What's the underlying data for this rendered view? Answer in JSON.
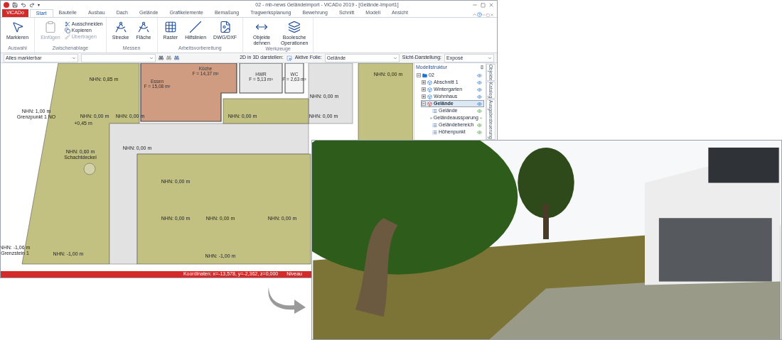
{
  "window": {
    "title": "02 - mb-news Geländeimport - ViCADo 2019 - [Gelände-Import1]"
  },
  "quick_access": {
    "more": "▾"
  },
  "file_tab": "ViCADo",
  "tabs": [
    {
      "label": "Start",
      "selected": true
    },
    {
      "label": "Bauteile",
      "selected": false
    },
    {
      "label": "Ausbau",
      "selected": false
    },
    {
      "label": "Dach",
      "selected": false
    },
    {
      "label": "Gelände",
      "selected": false
    },
    {
      "label": "Grafikelemente",
      "selected": false
    },
    {
      "label": "Bemaßung",
      "selected": false
    },
    {
      "label": "Tragwerksplanung",
      "selected": false
    },
    {
      "label": "Bewehrung",
      "selected": false
    },
    {
      "label": "Schnitt",
      "selected": false
    },
    {
      "label": "Modell",
      "selected": false
    },
    {
      "label": "Ansicht",
      "selected": false
    }
  ],
  "ribbon_groups": [
    {
      "title": "Auswahl",
      "items": [
        {
          "kind": "large",
          "label": "Markieren",
          "disabled": false
        }
      ]
    },
    {
      "title": "Zwischenablage",
      "items": [
        {
          "kind": "large",
          "label": "Einfügen",
          "disabled": true
        },
        {
          "kind": "small",
          "label": "Ausschneiden",
          "disabled": false
        },
        {
          "kind": "small",
          "label": "Kopieren",
          "disabled": false
        },
        {
          "kind": "small",
          "label": "Übertragen",
          "disabled": true
        }
      ]
    },
    {
      "title": "Messen",
      "items": [
        {
          "kind": "large",
          "label": "Strecke",
          "disabled": false
        },
        {
          "kind": "large",
          "label": "Fläche",
          "disabled": false
        }
      ]
    },
    {
      "title": "Arbeitsvorbereitung",
      "items": [
        {
          "kind": "large",
          "label": "Raster",
          "disabled": false
        },
        {
          "kind": "large",
          "label": "Hilfslinien",
          "disabled": false
        },
        {
          "kind": "large",
          "label": "DWG/DXF",
          "disabled": false
        }
      ]
    },
    {
      "title": "Werkzeuge",
      "items": [
        {
          "kind": "large",
          "label": "Objekte dehnen",
          "disabled": false
        },
        {
          "kind": "large",
          "label": "Boolesche Operationen",
          "disabled": false
        }
      ]
    }
  ],
  "toolbar": {
    "selection_filter": "Alles markierbar",
    "label_2d3d": "2D in 3D darstellen:",
    "active_layer_label": "Aktive Folie:",
    "active_layer": "Gelände",
    "view_label": "Sicht-Darstellung:",
    "view": "Exposé"
  },
  "plan": {
    "labels": [
      "NHN: 0,85 m",
      "NHN: 0,00 m",
      "NHN: 0,00 m",
      "NHN: 1,00 m",
      "Grenzpunkt 1 NO",
      "NHN: 0,00 m",
      "NHN: 0,00 m",
      "NHN: 0,00 m",
      "NHN: 0,00 m",
      "+0,45 m",
      "NHN: 0,00 m",
      "NHN: 0,60 m",
      "Schachtdeckel",
      "NHN: 0,00 m",
      "NHN: 0,00 m",
      "NHN: 0,00 m",
      "NHN: 0,00 m",
      "NHN: -1,06 m",
      "Grenzstein 1",
      "NHN: -1,00 m",
      "NHN: -1,00 m"
    ],
    "rooms": [
      {
        "name": "Küche",
        "area": "F = 14,37 m²"
      },
      {
        "name": "Essen",
        "area": "F = 15,08 m²"
      },
      {
        "name": "HWR",
        "area": "F = 5,13 m²"
      },
      {
        "name": "WC",
        "area": "F = 2,63 m²"
      }
    ]
  },
  "model_panel": {
    "title": "Modellstruktur",
    "tree": [
      {
        "label": "02",
        "expanded": true,
        "selected": false,
        "children": [
          {
            "label": "Abschnitt 1",
            "expanded": false,
            "selected": false
          },
          {
            "label": "Wintergarten",
            "expanded": false,
            "selected": false
          },
          {
            "label": "Wohnhaus",
            "expanded": false,
            "selected": false
          },
          {
            "label": "Gelände",
            "expanded": true,
            "selected": true,
            "children": [
              {
                "label": "Gelände",
                "selected": false
              },
              {
                "label": "Geländeaussparung",
                "selected": false
              },
              {
                "label": "Geländebereich",
                "selected": false
              },
              {
                "label": "Höhenpunkt",
                "selected": false
              }
            ]
          }
        ]
      }
    ]
  },
  "side_tabs": [
    "Objekte",
    "Katalog",
    "Ausgabesteuerung"
  ],
  "status_bar": {
    "coordinates": "Koordinaten: x=-13,578, y=-2,362, z=0,000",
    "level": "Niveau"
  }
}
